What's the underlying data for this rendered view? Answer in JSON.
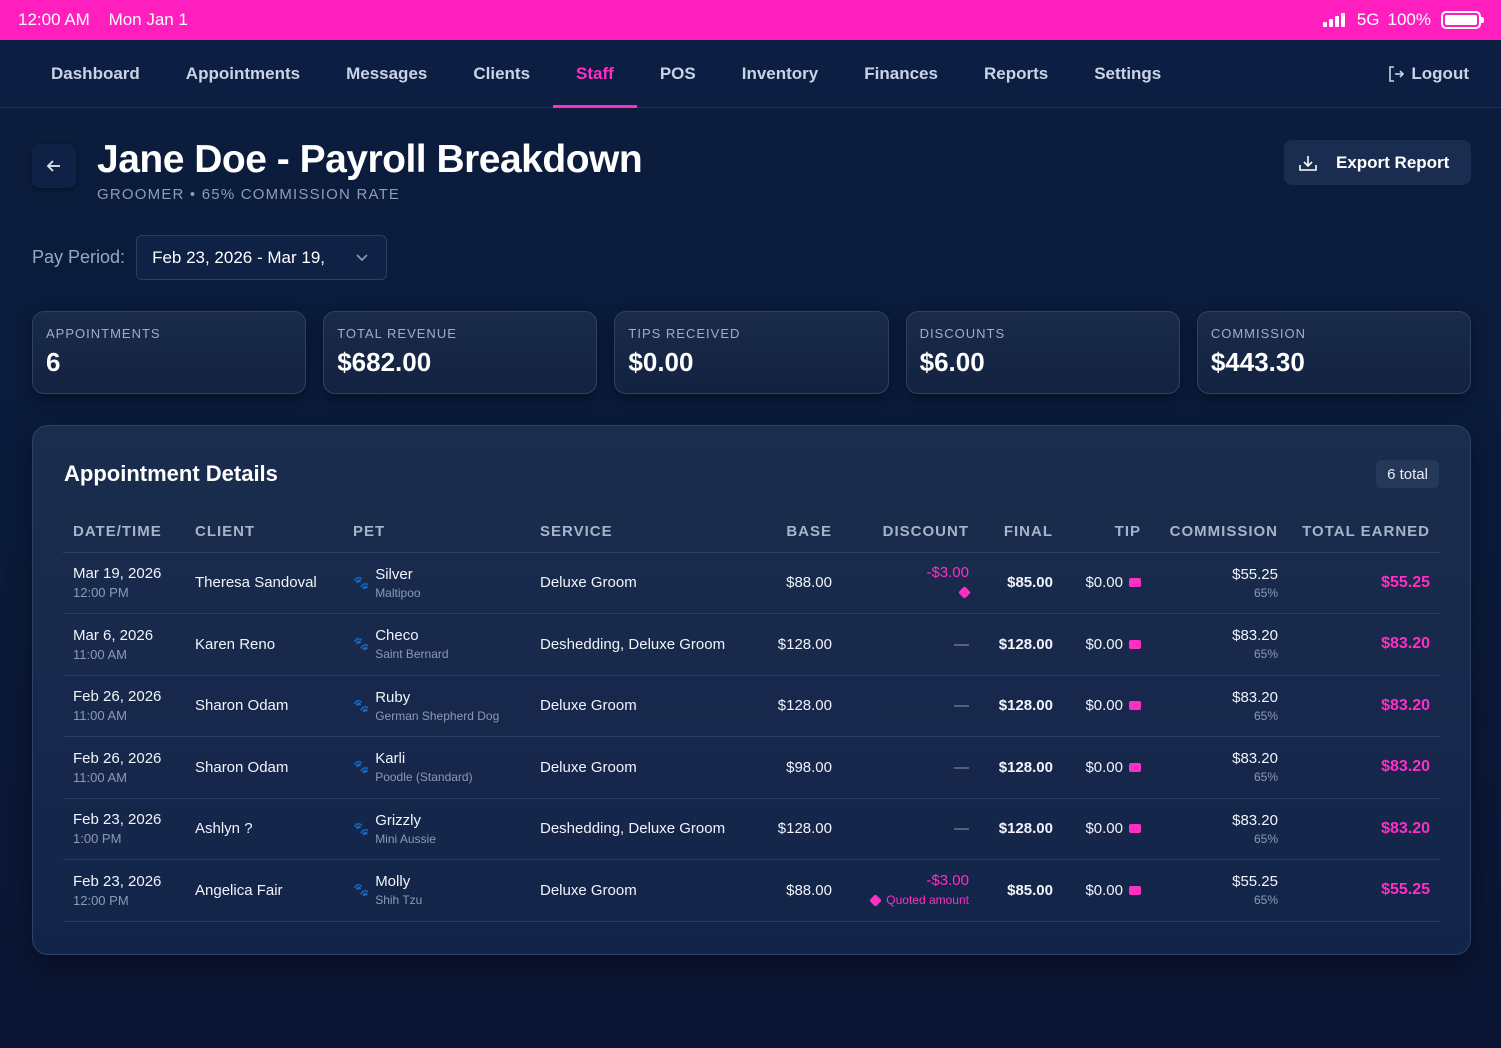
{
  "status_bar": {
    "time": "12:00 AM",
    "date": "Mon Jan 1",
    "network": "5G",
    "battery": "100%"
  },
  "nav": {
    "items": [
      "Dashboard",
      "Appointments",
      "Messages",
      "Clients",
      "Staff",
      "POS",
      "Inventory",
      "Finances",
      "Reports",
      "Settings"
    ],
    "active": "Staff",
    "logout_label": "Logout"
  },
  "header": {
    "title": "Jane Doe - Payroll Breakdown",
    "subtitle": "GROOMER • 65% COMMISSION RATE",
    "export_label": "Export Report"
  },
  "period": {
    "label": "Pay Period:",
    "value": "Feb 23, 2026 - Mar 19,"
  },
  "stats": [
    {
      "label": "APPOINTMENTS",
      "value": "6"
    },
    {
      "label": "TOTAL REVENUE",
      "value": "$682.00"
    },
    {
      "label": "TIPS RECEIVED",
      "value": "$0.00"
    },
    {
      "label": "DISCOUNTS",
      "value": "$6.00"
    },
    {
      "label": "COMMISSION",
      "value": "$443.30"
    }
  ],
  "details": {
    "title": "Appointment Details",
    "count": "6 total",
    "columns": [
      "DATE/TIME",
      "CLIENT",
      "PET",
      "SERVICE",
      "BASE",
      "DISCOUNT",
      "FINAL",
      "TIP",
      "COMMISSION",
      "TOTAL EARNED"
    ],
    "rows": [
      {
        "date": "Mar 19, 2026",
        "time": "12:00 PM",
        "client": "Theresa Sandoval",
        "pet": "Silver",
        "breed": "Maltipoo",
        "service": "Deluxe Groom",
        "base": "$88.00",
        "discount": "-$3.00",
        "discount_note": "",
        "final": "$85.00",
        "tip": "$0.00",
        "commission": "$55.25",
        "rate": "65%",
        "earned": "$55.25"
      },
      {
        "date": "Mar 6, 2026",
        "time": "11:00 AM",
        "client": "Karen Reno",
        "pet": "Checo",
        "breed": "Saint Bernard",
        "service": "Deshedding, Deluxe Groom",
        "base": "$128.00",
        "discount": "—",
        "discount_note": "",
        "final": "$128.00",
        "tip": "$0.00",
        "commission": "$83.20",
        "rate": "65%",
        "earned": "$83.20"
      },
      {
        "date": "Feb 26, 2026",
        "time": "11:00 AM",
        "client": "Sharon Odam",
        "pet": "Ruby",
        "breed": "German Shepherd Dog",
        "service": "Deluxe Groom",
        "base": "$128.00",
        "discount": "—",
        "discount_note": "",
        "final": "$128.00",
        "tip": "$0.00",
        "commission": "$83.20",
        "rate": "65%",
        "earned": "$83.20"
      },
      {
        "date": "Feb 26, 2026",
        "time": "11:00 AM",
        "client": "Sharon Odam",
        "pet": "Karli",
        "breed": "Poodle (Standard)",
        "service": "Deluxe Groom",
        "base": "$98.00",
        "discount": "—",
        "discount_note": "",
        "final": "$128.00",
        "tip": "$0.00",
        "commission": "$83.20",
        "rate": "65%",
        "earned": "$83.20"
      },
      {
        "date": "Feb 23, 2026",
        "time": "1:00 PM",
        "client": "Ashlyn ?",
        "pet": "Grizzly",
        "breed": "Mini Aussie",
        "service": "Deshedding, Deluxe Groom",
        "base": "$128.00",
        "discount": "—",
        "discount_note": "",
        "final": "$128.00",
        "tip": "$0.00",
        "commission": "$83.20",
        "rate": "65%",
        "earned": "$83.20"
      },
      {
        "date": "Feb 23, 2026",
        "time": "12:00 PM",
        "client": "Angelica Fair",
        "pet": "Molly",
        "breed": "Shih Tzu",
        "service": "Deluxe Groom",
        "base": "$88.00",
        "discount": "-$3.00",
        "discount_note": "Quoted amount",
        "final": "$85.00",
        "tip": "$0.00",
        "commission": "$55.25",
        "rate": "65%",
        "earned": "$55.25"
      }
    ]
  },
  "colors": {
    "accent": "#ff2fc4",
    "status_bar": "#ff1fbf",
    "background": "#0b1d3e"
  },
  "icons": {
    "back": "arrow-left-icon",
    "export": "download-icon",
    "logout": "logout-icon",
    "pet": "paw-icon",
    "discount": "tag-icon",
    "tip": "credit-card-icon"
  }
}
